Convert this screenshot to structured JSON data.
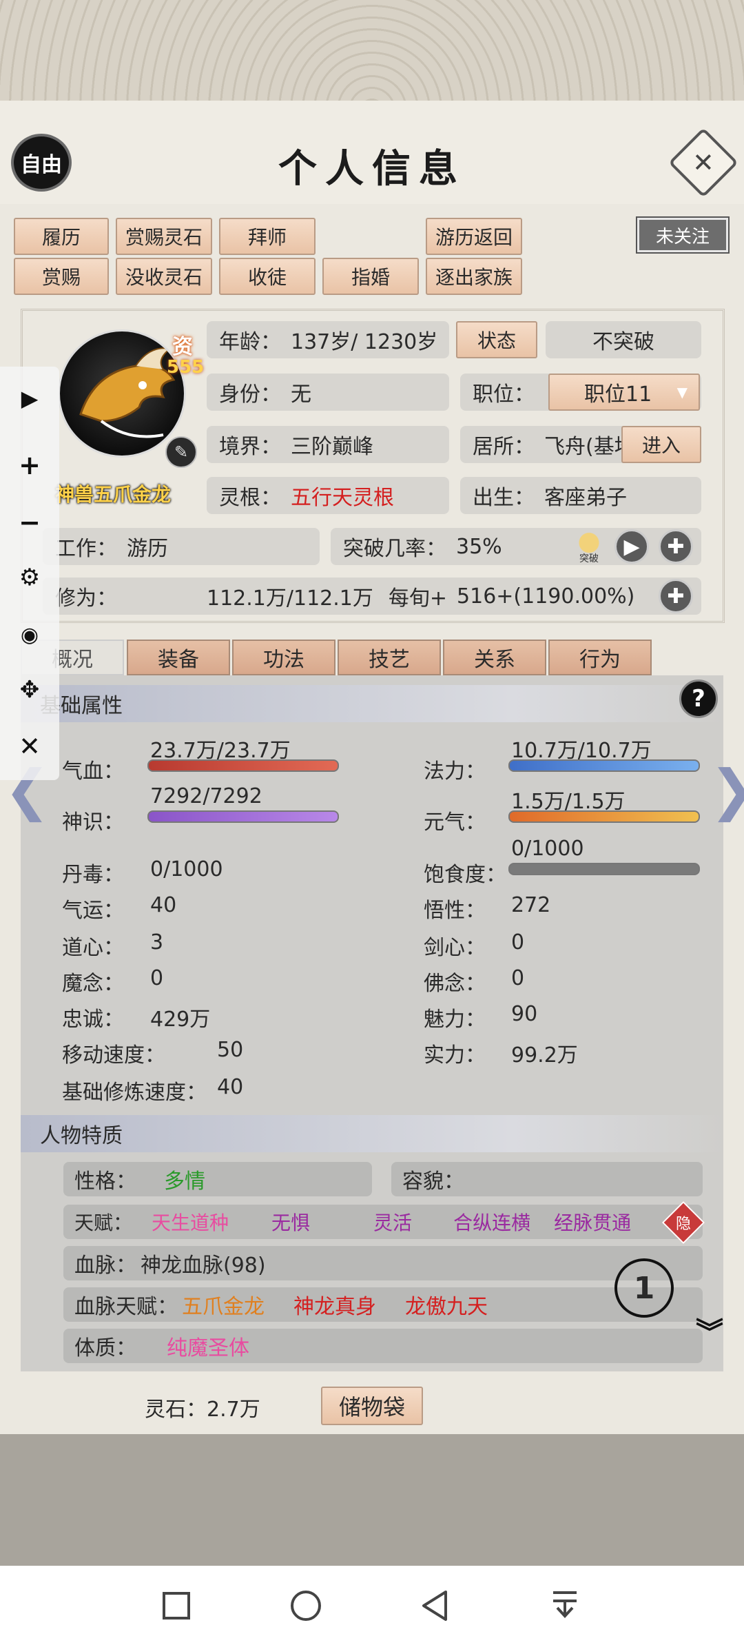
{
  "header": {
    "title": "个人信息",
    "free_label": "自由",
    "close_icon": "✕",
    "follow_label": "未关注"
  },
  "actions": {
    "row1": [
      "履历",
      "赏赐灵石",
      "拜师",
      "游历返回"
    ],
    "row2": [
      "赏赐",
      "没收灵石",
      "收徒",
      "指婚",
      "逐出家族"
    ]
  },
  "character": {
    "zi_label": "资",
    "zi_value": "555",
    "name": "神兽五爪金龙",
    "age_label": "年龄：",
    "age": "137岁/ 1230岁",
    "status_button": "状态",
    "status_value": "不突破",
    "identity_label": "身份：",
    "identity": "无",
    "position_label": "职位：",
    "position": "职位11",
    "realm_label": "境界：",
    "realm": "三阶巅峰",
    "residence_label": "居所：",
    "residence": "飞舟(基地",
    "enter_button": "进入",
    "root_label": "灵根：",
    "root": "五行天灵根",
    "birth_label": "出生：",
    "birth": "客座弟子",
    "work_label": "工作：",
    "work": "游历",
    "break_label": "突破几率：",
    "break_rate": "35%",
    "break_icon_label": "突破",
    "cultivation_label": "修为：",
    "cultivation": "112.1万/112.1万",
    "per_turn_label": "每旬+",
    "per_turn": "516+(1190.00%)"
  },
  "tabs": [
    "概况",
    "装备",
    "功法",
    "技艺",
    "关系",
    "行为"
  ],
  "basic": {
    "title": "基础属性",
    "help_icon": "?",
    "hp_label": "气血：",
    "hp": "23.7万/23.7万",
    "mp_label": "法力：",
    "mp": "10.7万/10.7万",
    "sense_label": "神识：",
    "sense": "7292/7292",
    "qi_label": "元气：",
    "qi": "1.5万/1.5万",
    "poison_label": "丹毒：",
    "poison": "0/1000",
    "food_label": "饱食度：",
    "food": "0/1000",
    "luck_label": "气运：",
    "luck": "40",
    "wit_label": "悟性：",
    "wit": "272",
    "dao_label": "道心：",
    "dao": "3",
    "sword_label": "剑心：",
    "sword": "0",
    "demon_label": "魔念：",
    "demon": "0",
    "buddha_label": "佛念：",
    "buddha": "0",
    "loyal_label": "忠诚：",
    "loyal": "429万",
    "charm_label": "魅力：",
    "charm": "90",
    "speed_label": "移动速度：",
    "speed": "50",
    "power_label": "实力：",
    "power": "99.2万",
    "train_label": "基础修炼速度：",
    "train": "40"
  },
  "traits": {
    "title": "人物特质",
    "personality_label": "性格：",
    "personality": "多情",
    "looks_label": "容貌：",
    "talent_label": "天赋：",
    "talents": [
      "天生道种",
      "无惧",
      "灵活",
      "合纵连横",
      "经脉贯通"
    ],
    "hide_label": "隐",
    "blood_label": "血脉：",
    "blood": "神龙血脉(98)",
    "blood_talent_label": "血脉天赋：",
    "blood_talents": [
      "五爪金龙",
      "神龙真身",
      "龙傲九天"
    ],
    "body_label": "体质：",
    "body": "纯魔圣体"
  },
  "footer": {
    "stones_label": "灵石：",
    "stones": "2.7万",
    "bag_button": "储物袋"
  },
  "colors": {
    "hp": "#c84b3f",
    "mp": "#5a8fd8",
    "sense": "#9a6ad0",
    "qi": "#e08a3a",
    "talent_pink": "#e84ca0",
    "talent_purple": "#9a2aa0",
    "blood_orange": "#e08020",
    "red": "#d42020",
    "green": "#2a9a2a"
  }
}
